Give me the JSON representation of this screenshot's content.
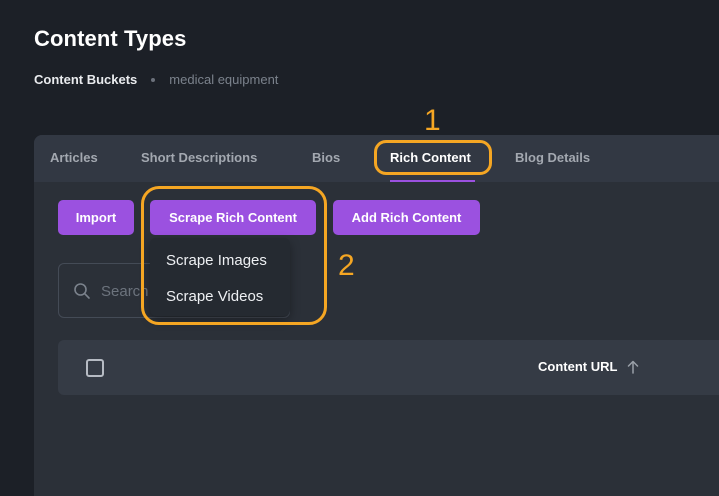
{
  "header": {
    "title": "Content Types",
    "breadcrumb": {
      "current": "Content Buckets",
      "sub": "medical equipment"
    }
  },
  "tabs": [
    {
      "label": "Articles",
      "active": false
    },
    {
      "label": "Short Descriptions",
      "active": false
    },
    {
      "label": "Bios",
      "active": false
    },
    {
      "label": "Rich Content",
      "active": true
    },
    {
      "label": "Blog Details",
      "active": false
    }
  ],
  "toolbar": {
    "import_label": "Import",
    "scrape_label": "Scrape Rich Content",
    "add_label": "Add Rich Content"
  },
  "dropdown": {
    "items": [
      "Scrape Images",
      "Scrape Videos"
    ]
  },
  "search": {
    "placeholder": "Search"
  },
  "table": {
    "columns": [
      "Content URL"
    ],
    "sort": "ascending"
  },
  "annotations": {
    "label1": "1",
    "label2": "2",
    "color": "#f5a623"
  },
  "colors": {
    "accent": "#9b51e0",
    "background": "#1c2027",
    "panel": "#2b3038"
  }
}
